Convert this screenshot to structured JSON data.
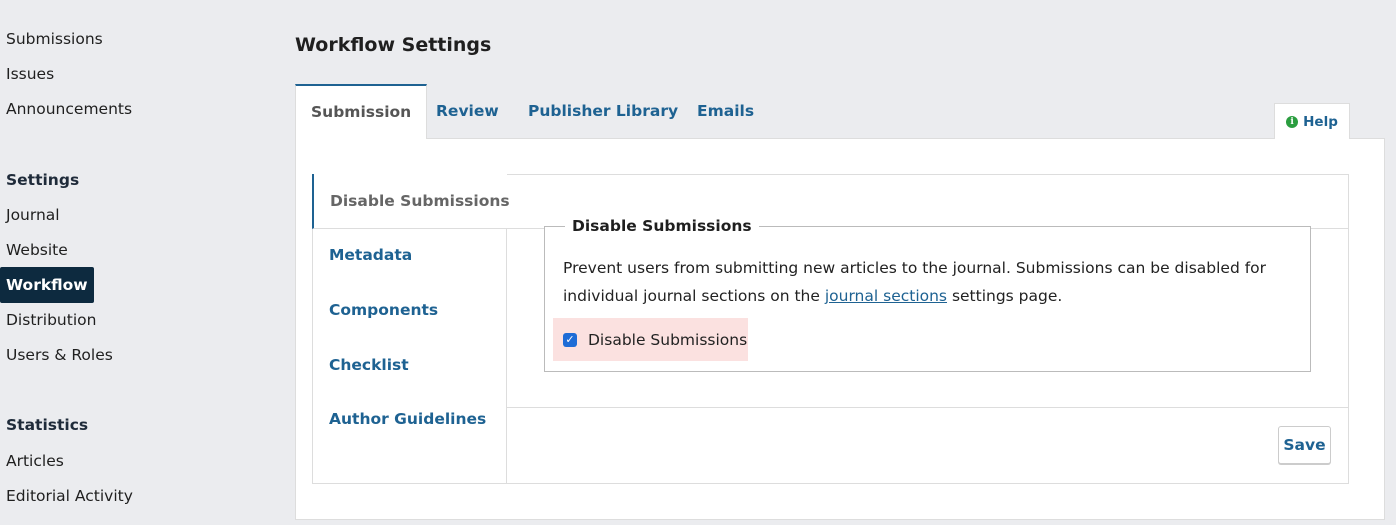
{
  "sidebar": {
    "group1": [
      "Submissions",
      "Issues",
      "Announcements"
    ],
    "settings_heading": "Settings",
    "settings_items": [
      "Journal",
      "Website",
      "Workflow",
      "Distribution",
      "Users & Roles"
    ],
    "statistics_heading": "Statistics",
    "statistics_items": [
      "Articles",
      "Editorial Activity"
    ]
  },
  "main": {
    "title": "Workflow Settings",
    "tabs": [
      "Submission",
      "Review",
      "Publisher Library",
      "Emails"
    ],
    "help_label": "Help",
    "side_tabs": [
      "Disable Submissions",
      "Metadata",
      "Components",
      "Checklist",
      "Author Guidelines"
    ],
    "section": {
      "legend": "Disable Submissions",
      "desc_before": "Prevent users from submitting new articles to the journal. Submissions can be disabled for individual journal sections on the ",
      "desc_link": "journal sections",
      "desc_after": " settings page.",
      "checkbox_label": "Disable Submissions",
      "checkbox_checked": true
    },
    "save_label": "Save"
  },
  "colors": {
    "accent": "#1e6292",
    "active_nav_bg": "#0d2a3f",
    "checkbox_row_bg": "#fbe1e0",
    "help_icon": "#2a9d3f"
  }
}
